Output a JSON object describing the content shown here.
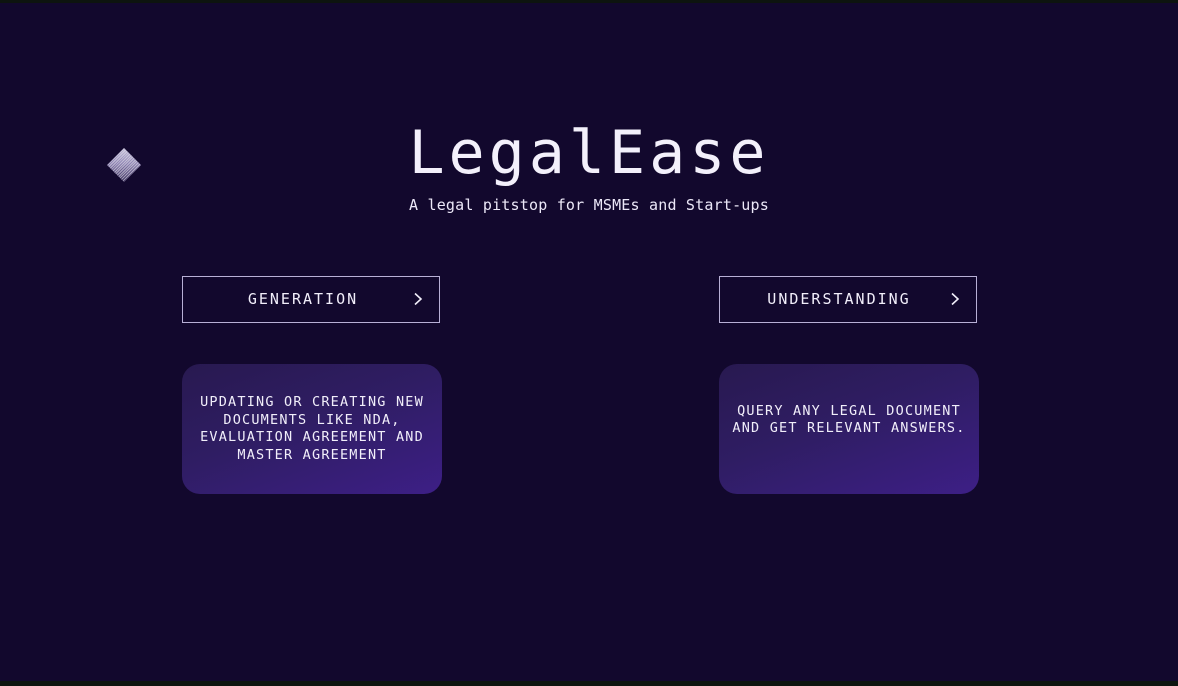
{
  "hero": {
    "title": "LegalEase",
    "subtitle": "A legal pitstop for MSMEs and Start-ups"
  },
  "sections": [
    {
      "button_label": "GENERATION",
      "button_icon": "chevron-right-icon",
      "description": "UPDATING OR CREATING NEW DOCUMENTS LIKE NDA, EVALUATION AGREEMENT AND MASTER AGREEMENT"
    },
    {
      "button_label": "UNDERSTANDING",
      "button_icon": "chevron-right-icon",
      "description": "QUERY ANY LEGAL DOCUMENT AND GET RELEVANT ANSWERS."
    }
  ],
  "colors": {
    "background": "#12082d",
    "card_gradient_start": "#281950",
    "card_gradient_end": "#3d1f86",
    "text": "#f1eefa",
    "button_border": "#b8b0d6"
  },
  "decor": {
    "icon": "diamond-logo-icon"
  }
}
